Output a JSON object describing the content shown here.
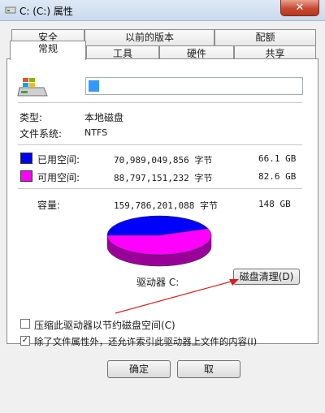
{
  "window": {
    "title": "C: (C:) 属性",
    "close_glyph": "✕"
  },
  "tabs_row1": [
    {
      "label": "安全"
    },
    {
      "label": "以前的版本"
    },
    {
      "label": "配额"
    }
  ],
  "tabs_row2": [
    {
      "label": "常规",
      "active": true
    },
    {
      "label": "工具"
    },
    {
      "label": "硬件"
    },
    {
      "label": "共享"
    }
  ],
  "general": {
    "drive_name_value": "",
    "type_label": "类型:",
    "type_value": "本地磁盘",
    "fs_label": "文件系统:",
    "fs_value": "NTFS",
    "used": {
      "label": "已用空间:",
      "bytes": "70,989,049,856 字节",
      "size": "66.1 GB",
      "color": "#0000ff"
    },
    "free": {
      "label": "可用空间:",
      "bytes": "88,797,151,232 字节",
      "size": "82.6 GB",
      "color": "#ff00ff"
    },
    "capacity": {
      "label": "容量:",
      "bytes": "159,786,201,088 字节",
      "size": "148 GB"
    },
    "drive_label": "驱动器 C:",
    "cleanup_button": "磁盘清理(D)",
    "compress_checkbox": {
      "label": "压缩此驱动器以节约磁盘空间(C)",
      "checked": false
    },
    "index_checkbox": {
      "label": "除了文件属性外，还允许索引此驱动器上文件的内容(I)",
      "checked": true
    }
  },
  "footer": {
    "ok_label": "确定",
    "cancel_label": "取"
  }
}
